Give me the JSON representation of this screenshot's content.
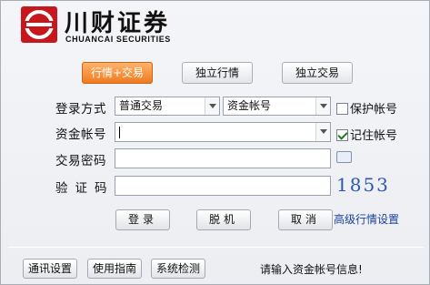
{
  "brand": {
    "name": "川财证券",
    "sub": "CHUANCAI SECURITIES"
  },
  "modes": [
    "行情+交易",
    "独立行情",
    "独立交易"
  ],
  "form": {
    "login_label": "登录方式",
    "login_type": "普通交易",
    "account_type": "资金帐号",
    "save_account": "保护帐号",
    "account_label": "资金帐号",
    "account_value": "",
    "remember_account": "记住帐号",
    "password_label": "交易密码",
    "captcha_label": "验证码",
    "captcha_value": "1853"
  },
  "actions": {
    "login": "登录",
    "offline": "脱机",
    "cancel": "取消",
    "advanced": "高级行情设置"
  },
  "footer": {
    "comm_settings": "通讯设置",
    "guide": "使用指南",
    "system_check": "系统检测",
    "status": "请输入资金帐号信息!"
  },
  "colors": {
    "brand_red": "#c8161d",
    "active_orange": "#f07a1e",
    "link_blue": "#1b3f9c",
    "captcha_blue": "#2b56b8"
  },
  "state": {
    "protect_account_checked": false,
    "remember_account_checked": true
  }
}
